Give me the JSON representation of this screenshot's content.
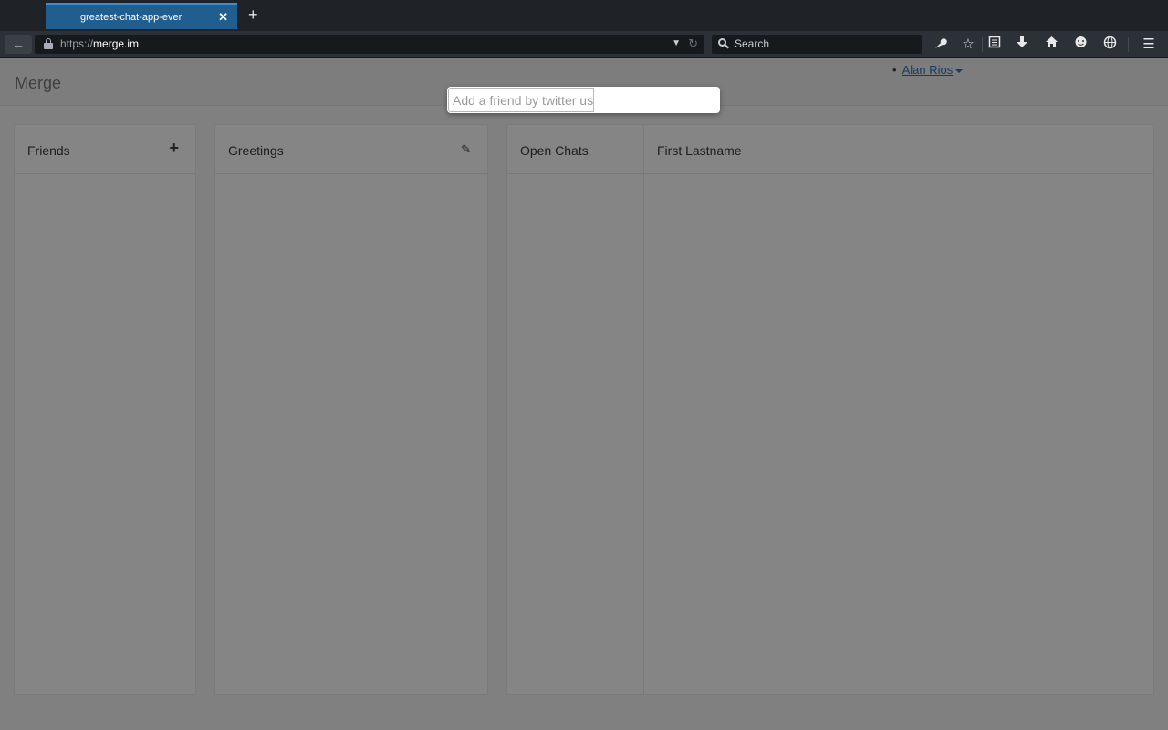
{
  "browser": {
    "tab": {
      "title": "greatest-chat-app-ever",
      "close": "✕"
    },
    "new_tab": "+",
    "back": "🡐",
    "url": {
      "scheme": "https://",
      "host": "merge.im"
    },
    "url_dropdown": "▼",
    "url_reload": "↻",
    "search_placeholder": "Search",
    "toolbar_icons": [
      "wrench-icon",
      "bookmark-star-icon",
      "reading-list-icon",
      "download-icon",
      "home-icon",
      "chat-icon",
      "globe-icon",
      "menu-icon"
    ]
  },
  "app": {
    "brand": "Merge",
    "user": {
      "name": "Alan Rios"
    },
    "add_friend_placeholder": "Add a friend by twitter username",
    "panels": {
      "friends": {
        "title": "Friends",
        "action": "+"
      },
      "greetings": {
        "title": "Greetings",
        "action": "✎"
      },
      "open_chats": {
        "title": "Open Chats"
      },
      "chat": {
        "title": "First Lastname"
      }
    }
  }
}
